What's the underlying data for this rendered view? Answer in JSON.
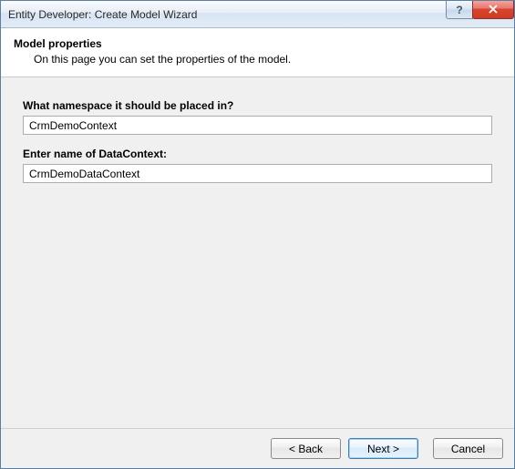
{
  "titlebar": {
    "title": "Entity Developer: Create Model Wizard"
  },
  "header": {
    "title": "Model properties",
    "subtitle": "On this page you can set the properties of the model."
  },
  "fields": {
    "namespace": {
      "label": "What namespace it should be placed in?",
      "value": "CrmDemoContext"
    },
    "datacontext": {
      "label": "Enter name of DataContext:",
      "value": "CrmDemoDataContext"
    }
  },
  "footer": {
    "back": "< Back",
    "next": "Next >",
    "cancel": "Cancel"
  }
}
